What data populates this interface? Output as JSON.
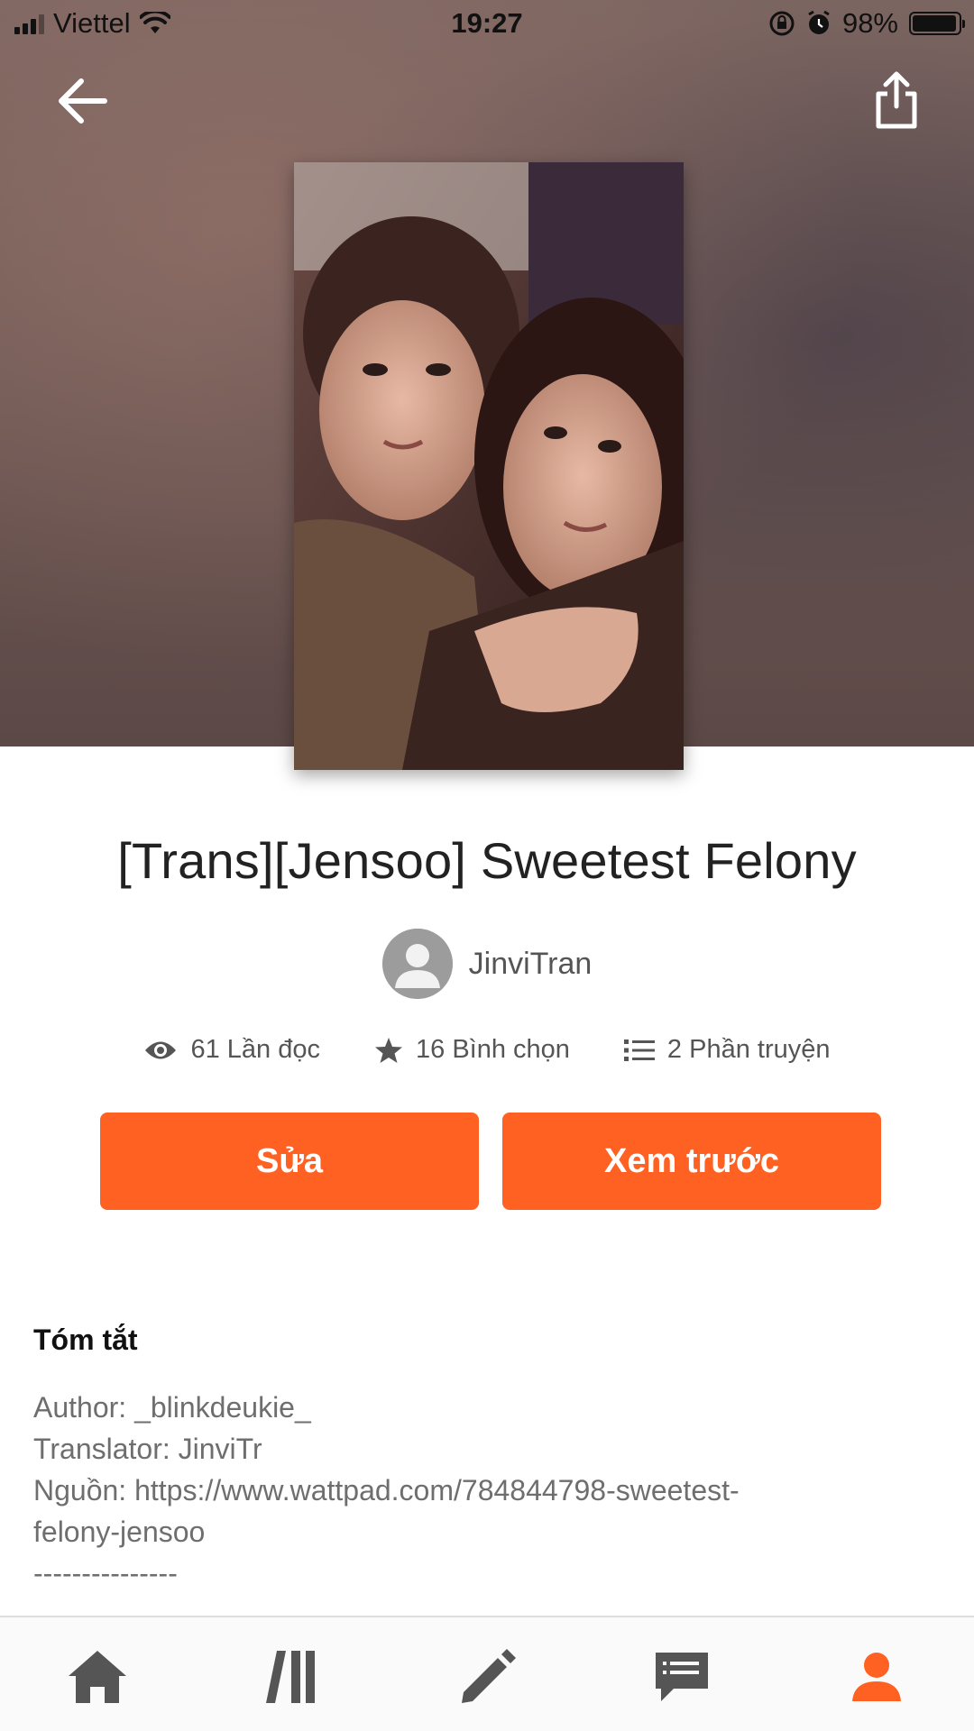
{
  "status_bar": {
    "carrier": "Viettel",
    "time": "19:27",
    "battery": "98%"
  },
  "story": {
    "title": "[Trans][Jensoo] Sweetest Felony",
    "author": "JinviTran",
    "reads": "61 Lần đọc",
    "votes": "16 Bình chọn",
    "parts": "2 Phần truyện"
  },
  "actions": {
    "edit_label": "Sửa",
    "preview_label": "Xem trước"
  },
  "summary": {
    "heading": "Tóm tắt",
    "lines": [
      "Author: _blinkdeukie_",
      "Translator: JinviTr",
      "Nguồn: https://www.wattpad.com/784844798-sweetest-",
      "felony-jensoo",
      "---------------"
    ]
  },
  "tabs": {
    "items": [
      "home-icon",
      "library-icon",
      "write-icon",
      "messages-icon",
      "profile-icon"
    ],
    "active": "profile-icon"
  },
  "colors": {
    "accent": "#ff6122",
    "icon_gray": "#555555",
    "active_tab": "#ff6122"
  }
}
